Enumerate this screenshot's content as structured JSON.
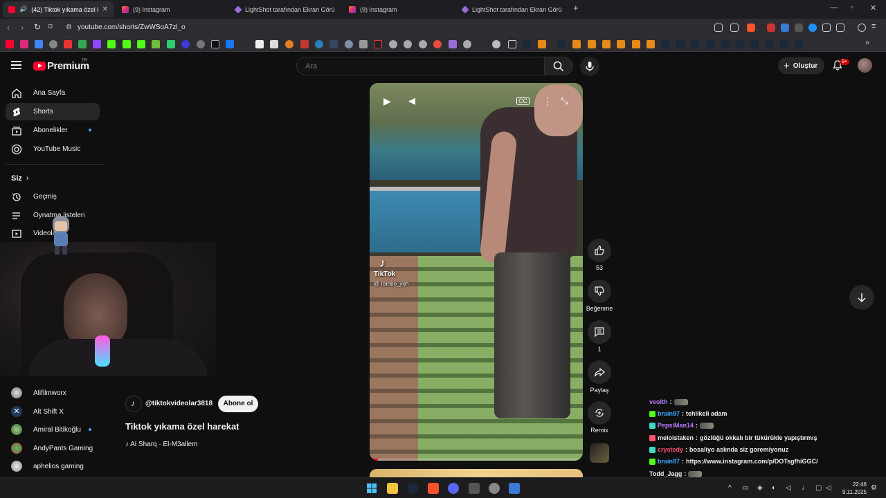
{
  "browser": {
    "tabs": [
      {
        "label": "(42) Tiktok yıkama özel hareka",
        "active": true
      },
      {
        "label": "(9) Instagram"
      },
      {
        "label": "LightShot tarafından Ekran Görüntüs"
      },
      {
        "label": "(9) Instagram"
      },
      {
        "label": "LightShot tarafından Ekran Görüntüs"
      }
    ],
    "url": "youtube.com/shorts/ZwWSoA7zl_o"
  },
  "header": {
    "logo": "Premium",
    "region": "TR",
    "search_placeholder": "Ara",
    "create_label": "Oluştur",
    "notification_count": "9+"
  },
  "sidebar": {
    "items": [
      {
        "label": "Ana Sayfa"
      },
      {
        "label": "Shorts"
      },
      {
        "label": "Abonelikler"
      },
      {
        "label": "YouTube Music"
      }
    ],
    "you_section": "Siz",
    "you_items": [
      {
        "label": "Geçmiş"
      },
      {
        "label": "Oynatma listeleri"
      },
      {
        "label": "Videolar"
      }
    ],
    "subscriptions": [
      {
        "label": "Alifilmworx"
      },
      {
        "label": "Alt Shift X"
      },
      {
        "label": "Amiral Bitikoğlu"
      },
      {
        "label": "AndyPants Gaming"
      },
      {
        "label": "aphelios gaming"
      }
    ]
  },
  "video": {
    "channel": "@tiktokvideolar3818",
    "subscribe_label": "Abone ol",
    "title": "Tiktok yıkama özel harekat",
    "music": "Al Sharq · El-M3allem",
    "tiktok_logo": "TikTok",
    "tiktok_user": "@ rambo_yoh",
    "progress": 0.04
  },
  "actions": {
    "like_count": "53",
    "dislike_label": "Beğenme",
    "comment_count": "1",
    "share_label": "Paylaş",
    "remix_label": "Remix"
  },
  "chat": [
    {
      "user": "veolth",
      "color": "#b57cff",
      "text": ""
    },
    {
      "user": "brain97",
      "color": "#3ea6ff",
      "text": "tehlikeli adam"
    },
    {
      "user": "PepsiMan14",
      "color": "#b57cff",
      "text": ""
    },
    {
      "user": "meloistaken",
      "color": "#f1f1f1",
      "text": "gözlüğü okkalı bir tükürükle yapıştırmış"
    },
    {
      "user": "crystedy",
      "color": "#ff4f6d",
      "text": "bosaliyo aslında siz goremiyonuz"
    },
    {
      "user": "brain97",
      "color": "#3ea6ff",
      "text": "https://www.instagram.com/p/DOTsgfhiGGC/"
    },
    {
      "user": "Todd_Jagg",
      "color": "#f1f1f1",
      "text": ""
    }
  ],
  "taskbar": {
    "time": "22:46",
    "date": "9.11.2025"
  }
}
